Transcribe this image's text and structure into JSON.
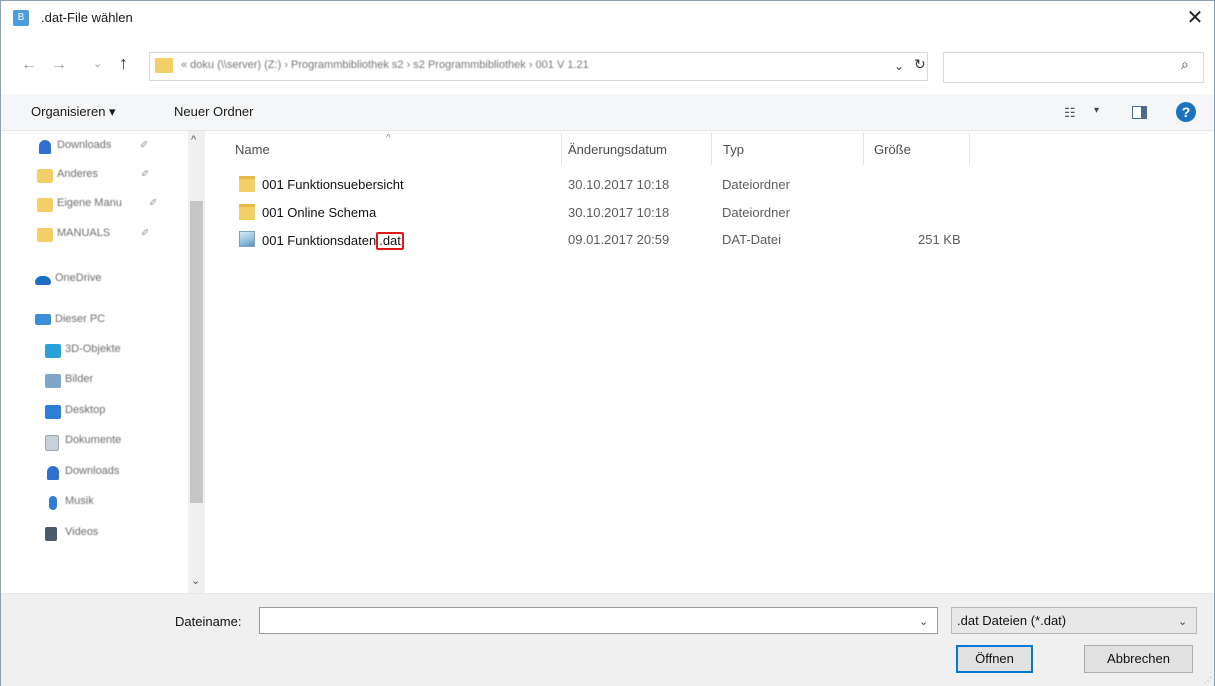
{
  "window": {
    "title": ".dat-File wählen",
    "close_glyph": "✕",
    "app_icon_letter": "B"
  },
  "address": {
    "back_glyph": "←",
    "forward_glyph": "→",
    "recent_glyph": "⌄",
    "up_glyph": "↑",
    "breadcrumb": "« doku (\\\\server) (Z:)  ›  Programmbibliothek s2  ›  s2 Programmbibliothek  ›  001 V 1.21",
    "dropdown_glyph": "⌄",
    "refresh_glyph": "↻",
    "search_placeholder": "",
    "search_glyph": "⌕"
  },
  "toolbar": {
    "organize": "Organisieren ▾",
    "new_folder": "Neuer Ordner",
    "view_glyph": "☷",
    "view_drop": "▾",
    "help": "?"
  },
  "nav": {
    "items": [
      {
        "label": "Downloads",
        "icon": "download-icon",
        "color": "#2f6fd0",
        "pin": "✐"
      },
      {
        "label": "Anderes",
        "icon": "folder-icon",
        "color": "#f2cf67",
        "pin": "✐"
      },
      {
        "label": "Eigene Manu",
        "icon": "folder-icon",
        "color": "#f2cf67",
        "pin": "✐"
      },
      {
        "label": "MANUALS",
        "icon": "folder-icon",
        "color": "#f2cf67",
        "pin": "✐"
      },
      {
        "label": "OneDrive",
        "icon": "cloud-icon",
        "color": "#1e6fc4",
        "pin": ""
      },
      {
        "label": "Dieser PC",
        "icon": "pc-icon",
        "color": "#3b8fd8",
        "pin": ""
      },
      {
        "label": "3D-Objekte",
        "icon": "cube-icon",
        "color": "#2aa1d8",
        "pin": ""
      },
      {
        "label": "Bilder",
        "icon": "pictures-icon",
        "color": "#7fa6c8",
        "pin": ""
      },
      {
        "label": "Desktop",
        "icon": "desktop-icon",
        "color": "#2f7fd6",
        "pin": ""
      },
      {
        "label": "Dokumente",
        "icon": "documents-icon",
        "color": "#9aa9b8",
        "pin": ""
      },
      {
        "label": "Downloads",
        "icon": "download-icon",
        "color": "#2f6fd0",
        "pin": ""
      },
      {
        "label": "Musik",
        "icon": "music-icon",
        "color": "#2f7fd6",
        "pin": ""
      },
      {
        "label": "Videos",
        "icon": "video-icon",
        "color": "#4a5a6a",
        "pin": ""
      }
    ],
    "scroll_up": "^",
    "scroll_down": "⌄"
  },
  "columns": {
    "name": "Name",
    "date": "Änderungsdatum",
    "type": "Typ",
    "size": "Größe",
    "sort": "^"
  },
  "files": [
    {
      "name": "001 Funktionsuebersicht",
      "ext": "",
      "date": "30.10.2017 10:18",
      "type": "Dateiordner",
      "size": "",
      "kind": "folder"
    },
    {
      "name": "001 Online Schema",
      "ext": "",
      "date": "30.10.2017 10:18",
      "type": "Dateiordner",
      "size": "",
      "kind": "folder"
    },
    {
      "name": "001 Funktionsdaten",
      "ext": ".dat",
      "date": "09.01.2017 20:59",
      "type": "DAT-Datei",
      "size": "251 KB",
      "kind": "dat"
    }
  ],
  "bottom": {
    "filename_label": "Dateiname:",
    "filename_value": "",
    "dropdown_glyph": "⌄",
    "filter": ".dat Dateien (*.dat)",
    "open": "Öffnen",
    "cancel": "Abbrechen",
    "grip": "⋰"
  }
}
